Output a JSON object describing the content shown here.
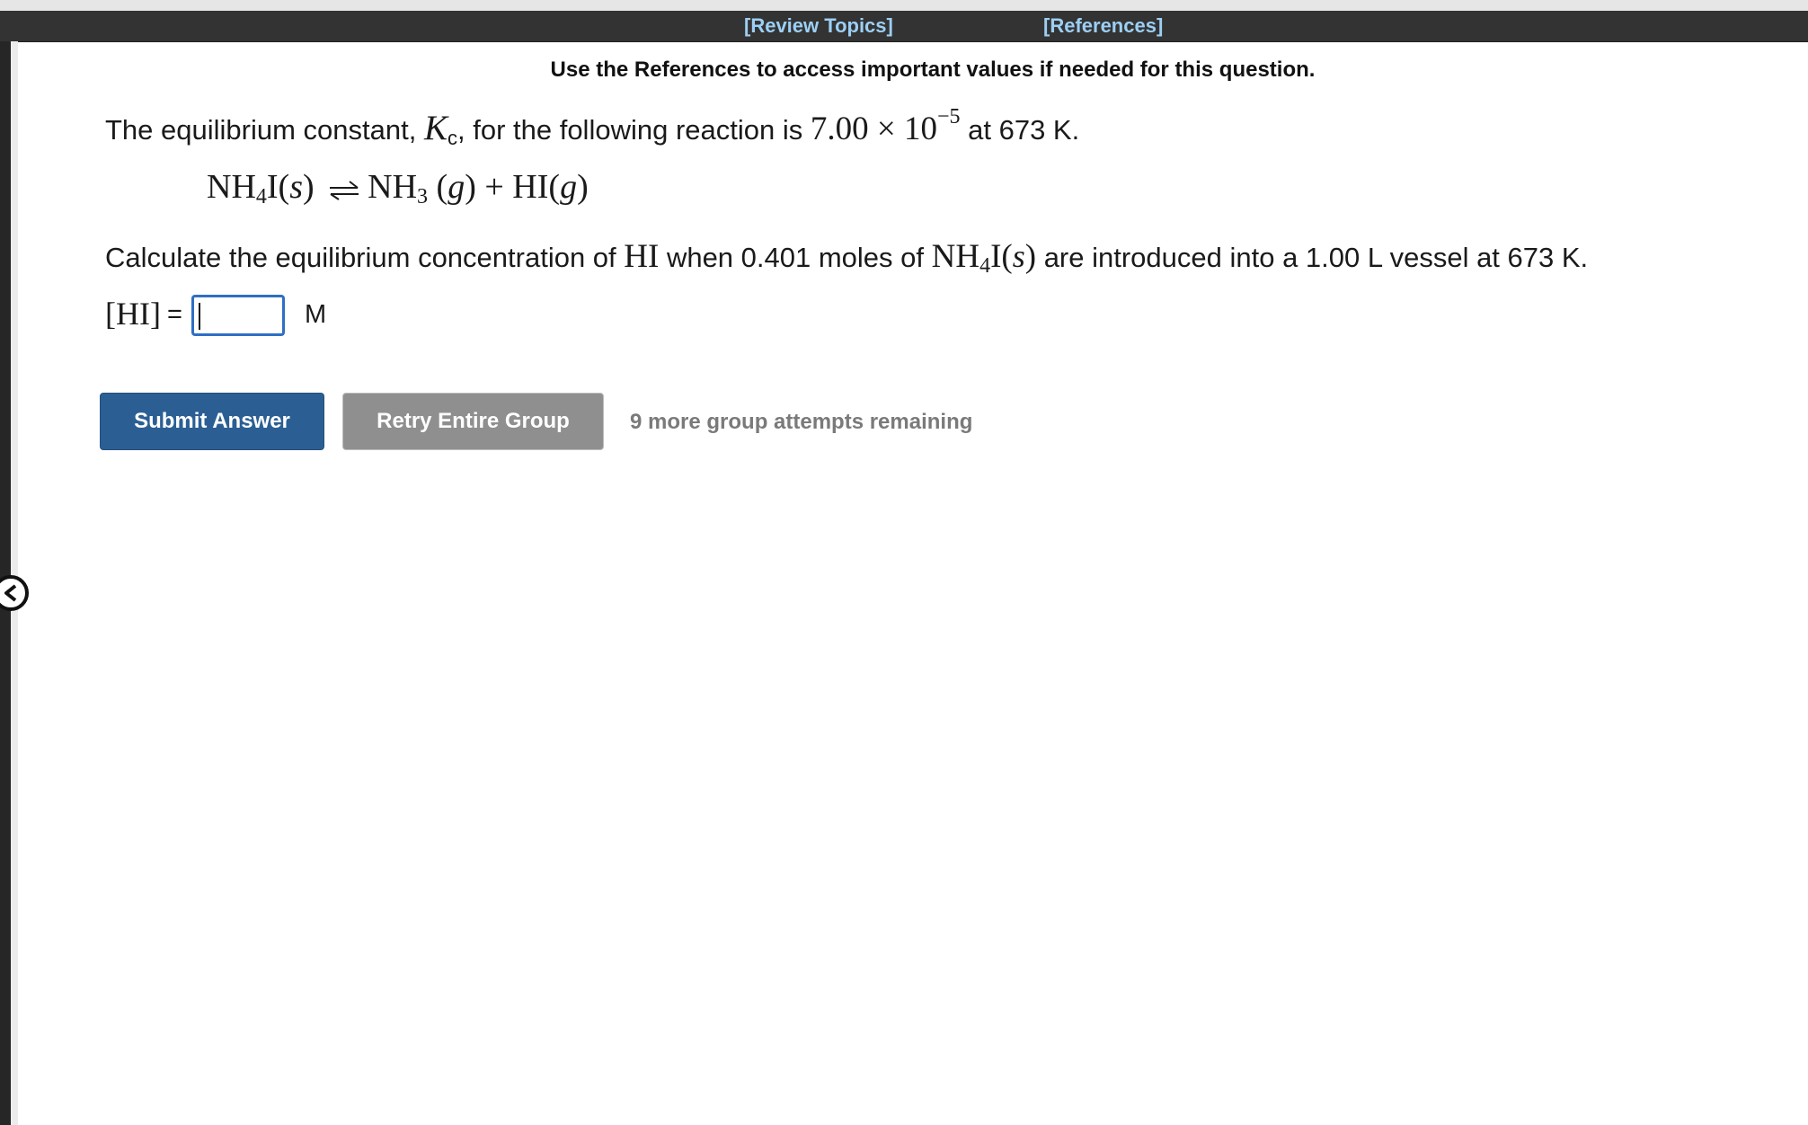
{
  "header": {
    "review_topics": "[Review Topics]",
    "references": "[References]"
  },
  "notice": "Use the References to access important values if needed for this question.",
  "question": {
    "line1_prefix": "The equilibrium constant, ",
    "kc_symbol": "K",
    "kc_subscript": "c",
    "line1_middle": ", for the following reaction is ",
    "kc_mantissa": "7.00 × 10",
    "kc_exponent": "−5",
    "line1_suffix": " at 673 K.",
    "reaction": {
      "reactant": "NH",
      "reactant_sub": "4",
      "reactant_rest": "I(",
      "reactant_state": "s",
      "reactant_close": ")",
      "product1": "NH",
      "product1_sub": "3",
      "product1_state_open": " (",
      "product1_state": "g",
      "product1_close": ")",
      "plus": " + ",
      "product2": "HI(",
      "product2_state": "g",
      "product2_close": ")"
    },
    "line2_prefix": "Calculate the equilibrium concentration of ",
    "line2_species": "HI",
    "line2_middle": " when 0.401 moles of ",
    "line2_compound": "NH",
    "line2_compound_sub": "4",
    "line2_compound_rest": "I(",
    "line2_compound_state": "s",
    "line2_compound_close": ")",
    "line2_suffix": " are introduced into a 1.00 L vessel at 673 K."
  },
  "answer": {
    "label": "[HI]",
    "equals": "=",
    "value": "",
    "unit": "M"
  },
  "buttons": {
    "submit": "Submit Answer",
    "retry": "Retry Entire Group"
  },
  "attempts_text": "9 more group attempts remaining",
  "icons": {
    "collapse_handle": "chevron-left-icon",
    "equilibrium_arrow": "equilibrium-arrow-icon"
  },
  "colors": {
    "top_bar": "#333333",
    "link": "#9ccff5",
    "submit_bg": "#2b5f94",
    "retry_bg": "#8f8f8f",
    "input_border": "#2f6fc4",
    "attempts_text": "#7a7a7a"
  }
}
